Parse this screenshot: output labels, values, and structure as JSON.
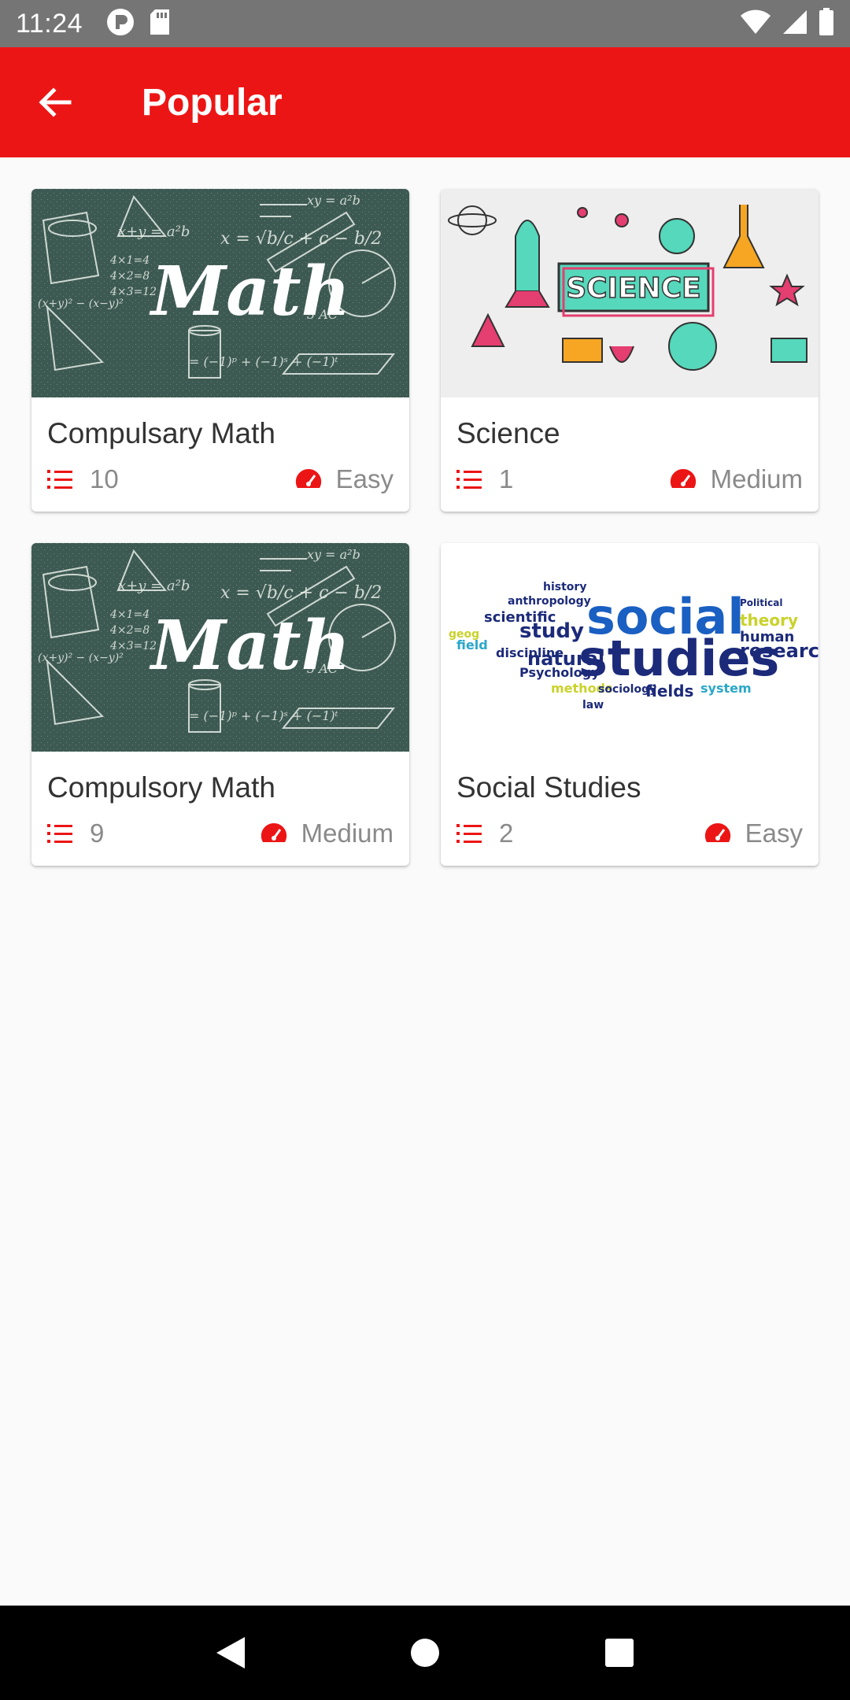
{
  "status_bar": {
    "time": "11:24",
    "left_icons": [
      "p-circle-icon",
      "sd-card-icon"
    ],
    "right_icons": [
      "wifi-icon",
      "signal-icon",
      "battery-icon"
    ]
  },
  "app_bar": {
    "title": "Popular",
    "back_icon": "arrow-back-icon",
    "color": "#ec1515"
  },
  "cards": [
    {
      "title": "Compulsary Math",
      "count": "10",
      "level": "Easy",
      "image": "math-chalkboard-image"
    },
    {
      "title": "Science",
      "count": "1",
      "level": "Medium",
      "image": "science-doodle-image"
    },
    {
      "title": "Compulsory Math",
      "count": "9",
      "level": "Medium",
      "image": "math-chalkboard-image"
    },
    {
      "title": "Social Studies",
      "count": "2",
      "level": "Easy",
      "image": "social-studies-wordcloud-image"
    }
  ],
  "nav_bar": {
    "icons": [
      "back-triangle-icon",
      "home-circle-icon",
      "recents-square-icon"
    ]
  },
  "colors": {
    "accent": "#ec1515",
    "chalkboard": "#3d5a52",
    "status_bar": "#757575"
  }
}
